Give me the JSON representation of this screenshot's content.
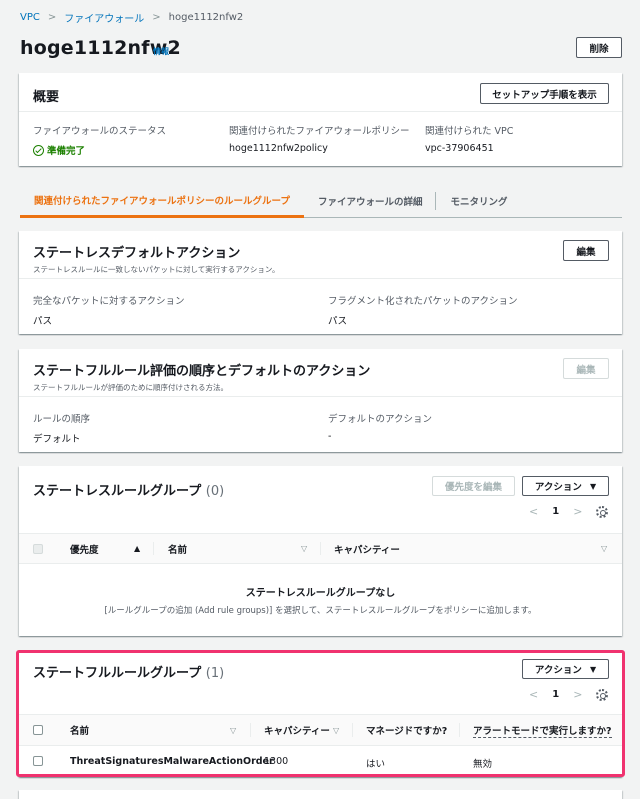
{
  "breadcrumb": {
    "root": "VPC",
    "section": "ファイアウォール",
    "current": "hoge1112nfw2"
  },
  "page": {
    "title": "hoge1112nfw2",
    "info": "情報",
    "delete_label": "削除"
  },
  "overview": {
    "title": "概要",
    "setup_button": "セットアップ手順を表示",
    "status_label": "ファイアウォールのステータス",
    "status_value": "準備完了",
    "policy_label": "関連付けられたファイアウォールポリシー",
    "policy_value": "hoge1112nfw2policy",
    "vpc_label": "関連付けられた VPC",
    "vpc_value": "vpc-37906451"
  },
  "tabs": [
    {
      "label": "関連付けられたファイアウォールポリシーのルールグループ"
    },
    {
      "label": "ファイアウォールの詳細"
    },
    {
      "label": "モニタリング"
    }
  ],
  "stateless_default": {
    "title": "ステートレスデフォルトアクション",
    "subtitle": "ステートレスルールに一致しないパケットに対して実行するアクション。",
    "edit_label": "編集",
    "full_label": "完全なパケットに対するアクション",
    "full_value": "パス",
    "frag_label": "フラグメント化されたパケットのアクション",
    "frag_value": "パス"
  },
  "stateful_order": {
    "title": "ステートフルルール評価の順序とデフォルトのアクション",
    "subtitle": "ステートフルルールが評価のために順序付けされる方法。",
    "edit_label": "編集",
    "order_label": "ルールの順序",
    "order_value": "デフォルト",
    "default_label": "デフォルトのアクション",
    "default_value": "-"
  },
  "stateless_groups": {
    "title": "ステートレスルールグループ",
    "count": "(0)",
    "edit_priority_label": "優先度を編集",
    "actions_label": "アクション",
    "page": "1",
    "columns": [
      "優先度",
      "名前",
      "キャパシティー"
    ],
    "empty_title": "ステートレスルールグループなし",
    "empty_desc": "[ルールグループの追加 (Add rule groups)] を選択して、ステートレスルールグループをポリシーに追加します。"
  },
  "stateful_groups": {
    "title": "ステートフルルールグループ",
    "count": "(1)",
    "actions_label": "アクション",
    "page": "1",
    "columns": [
      "名前",
      "キャパシティー",
      "マネージドですか?",
      "アラートモードで実行しますか?"
    ],
    "rows": [
      {
        "name": "ThreatSignaturesMalwareActionOrder",
        "capacity": "1300",
        "managed": "はい",
        "alert": "無効"
      }
    ]
  },
  "icons": {
    "ok": "check-circle-icon",
    "gear": "settings-gear-icon",
    "caret": "caret-down-icon"
  },
  "colors": {
    "accent": "#ec7211",
    "link": "#0073bb",
    "success": "#1d8102",
    "highlight": "#f0326f"
  }
}
